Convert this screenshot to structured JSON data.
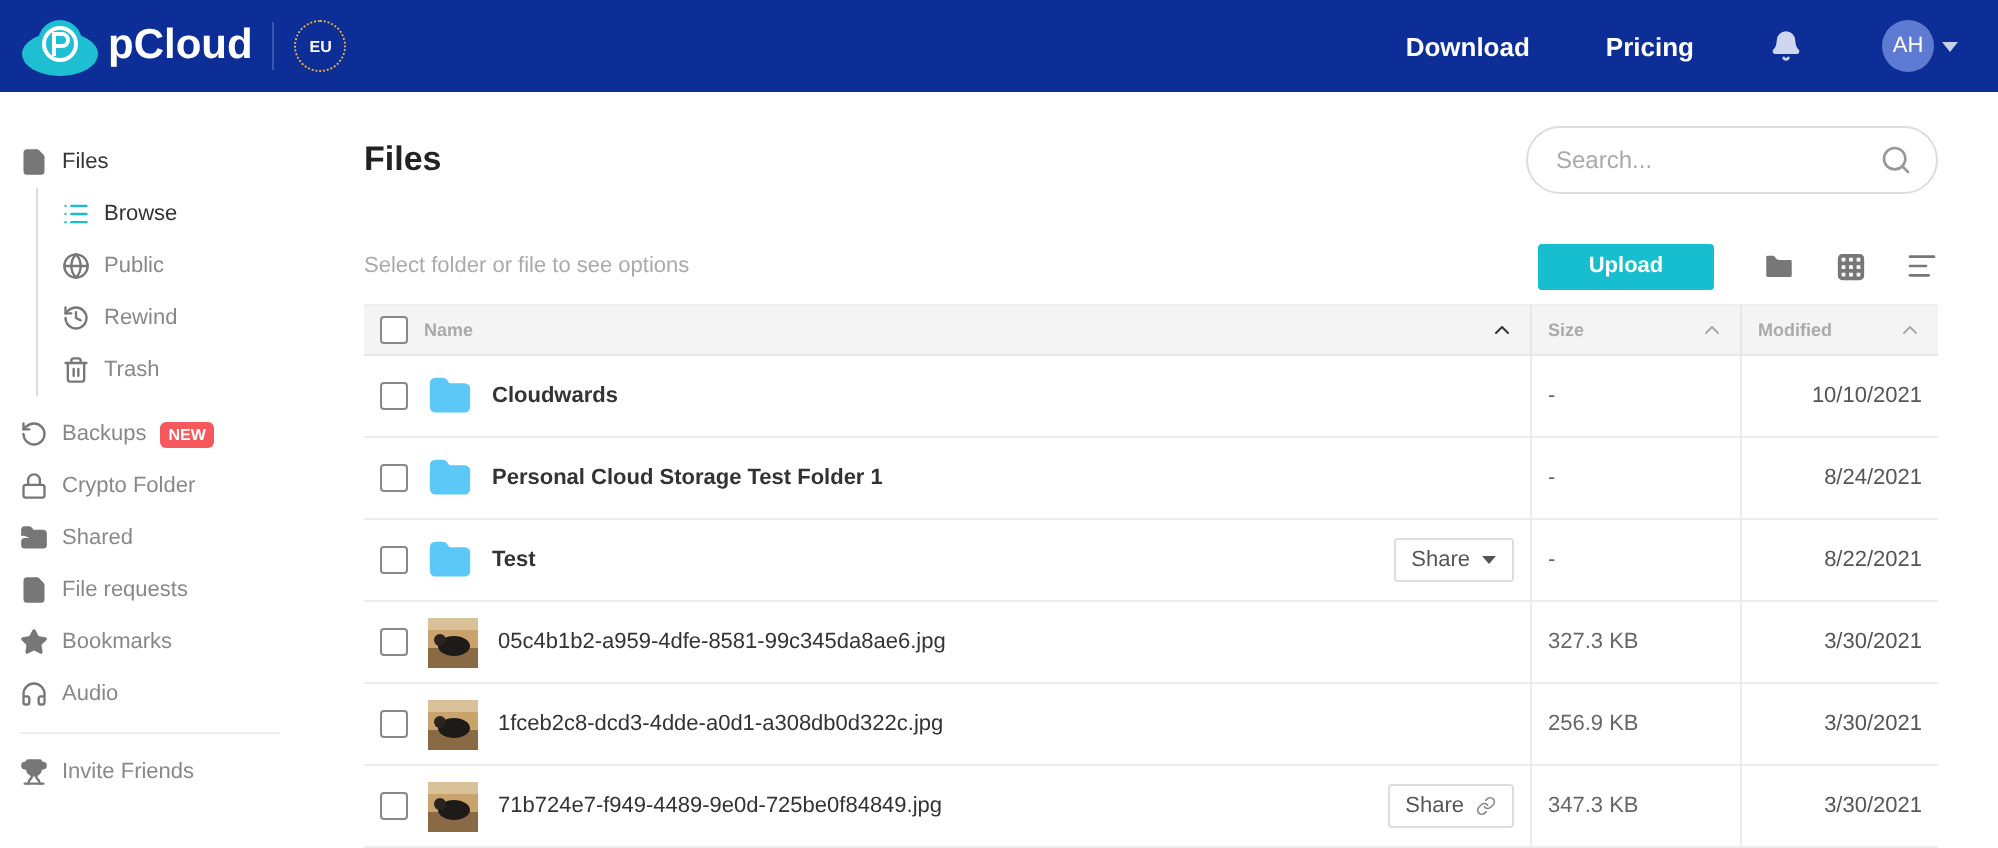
{
  "header": {
    "brand": "pCloud",
    "region": "EU",
    "nav": [
      "Download",
      "Pricing"
    ],
    "avatar": "AH"
  },
  "sidebar": {
    "items": [
      {
        "label": "Files",
        "selected": false,
        "children": [
          {
            "label": "Browse",
            "selected": true
          },
          {
            "label": "Public",
            "selected": false
          },
          {
            "label": "Rewind",
            "selected": false
          },
          {
            "label": "Trash",
            "selected": false
          }
        ]
      },
      {
        "label": "Backups",
        "selected": false,
        "badge": "NEW"
      },
      {
        "label": "Crypto Folder",
        "selected": false
      },
      {
        "label": "Shared",
        "selected": false
      },
      {
        "label": "File requests",
        "selected": false
      },
      {
        "label": "Bookmarks",
        "selected": false
      },
      {
        "label": "Audio",
        "selected": false
      }
    ],
    "footer_items": [
      {
        "label": "Invite Friends",
        "selected": false
      }
    ]
  },
  "main": {
    "title": "Files",
    "search": {
      "placeholder": "Search..."
    },
    "hint": "Select folder or file to see options",
    "upload": "Upload"
  },
  "table": {
    "select_all": {
      "checked": false
    },
    "columns": [
      "Name",
      "Size",
      "Modified"
    ],
    "rows": [
      {
        "kind": "folder",
        "name": "Cloudwards",
        "size": "-",
        "modified": "10/10/2021",
        "checked": false
      },
      {
        "kind": "folder",
        "name": "Personal Cloud Storage Test Folder 1",
        "size": "-",
        "modified": "8/24/2021",
        "checked": false
      },
      {
        "kind": "folder",
        "name": "Test",
        "size": "-",
        "modified": "8/22/2021",
        "checked": false,
        "share": {
          "kind": "menu",
          "label": "Share"
        }
      },
      {
        "kind": "picture",
        "name": "05c4b1b2-a959-4dfe-8581-99c345da8ae6.jpg",
        "size": "327.3 KB",
        "modified": "3/30/2021",
        "checked": false
      },
      {
        "kind": "picture",
        "name": "1fceb2c8-dcd3-4dde-a0d1-a308db0d322c.jpg",
        "size": "256.9 KB",
        "modified": "3/30/2021",
        "checked": false
      },
      {
        "kind": "picture",
        "name": "71b724e7-f949-4489-9e0d-725be0f84849.jpg",
        "size": "347.3 KB",
        "modified": "3/30/2021",
        "checked": false,
        "share": {
          "kind": "link",
          "label": "Share"
        }
      }
    ]
  }
}
